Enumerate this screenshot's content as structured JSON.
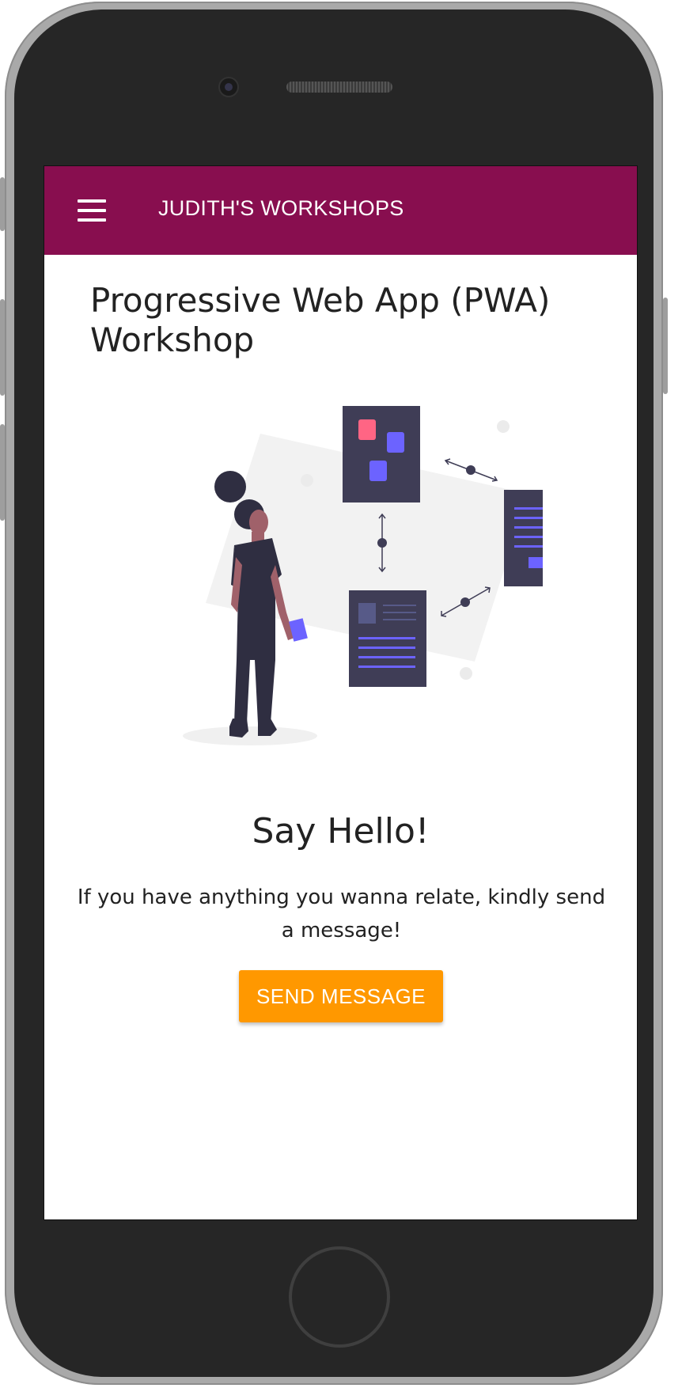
{
  "app_bar": {
    "title": "JUDITH'S WORKSHOPS",
    "background": "#880e4f",
    "menu_icon": "hamburger-menu-icon"
  },
  "main": {
    "title": "Progressive Web App (PWA) Workshop",
    "illustration": "woman-looking-at-connected-documents"
  },
  "contact": {
    "heading": "Say Hello!",
    "message": "If you have anything you wanna relate, kindly send a message!",
    "button_label": "SEND MESSAGE",
    "button_color": "#ff9800"
  }
}
